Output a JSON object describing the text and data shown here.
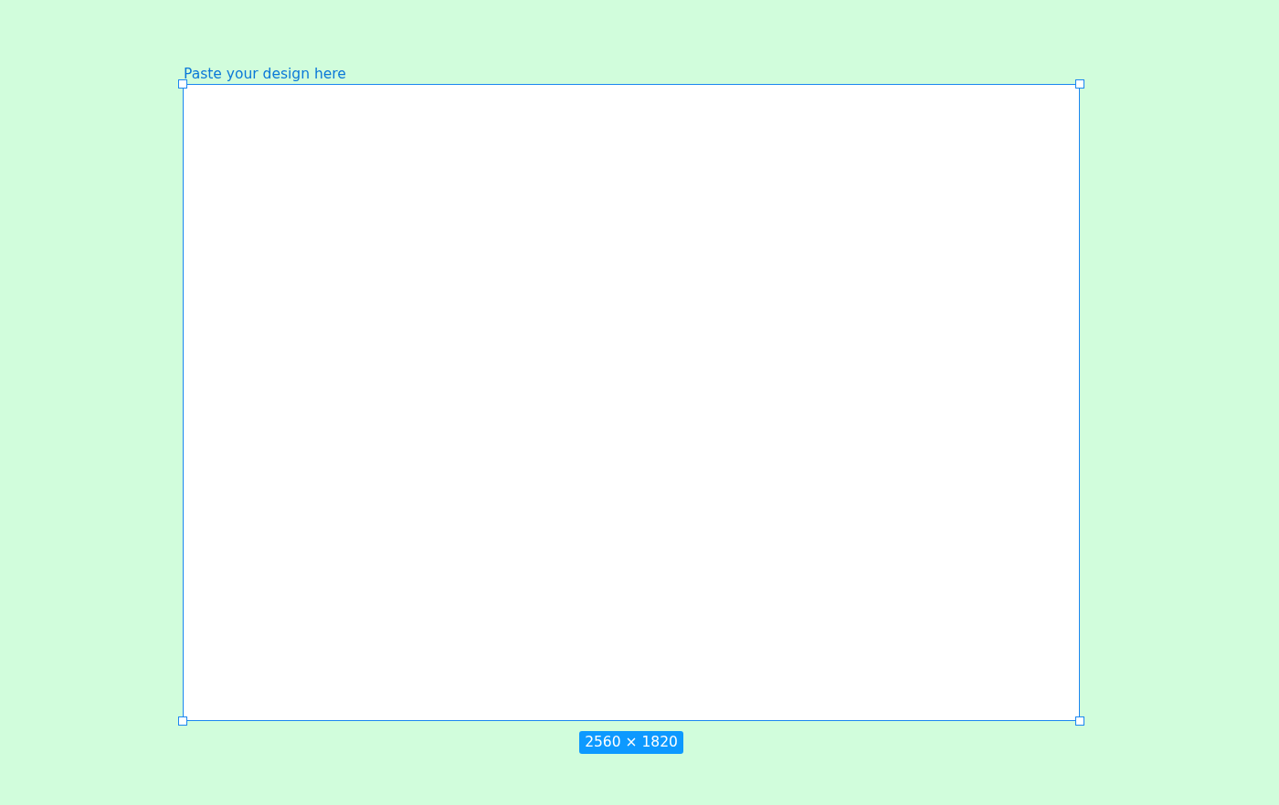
{
  "frame": {
    "label": "Paste your design here",
    "size_badge": "2560 × 1820"
  }
}
